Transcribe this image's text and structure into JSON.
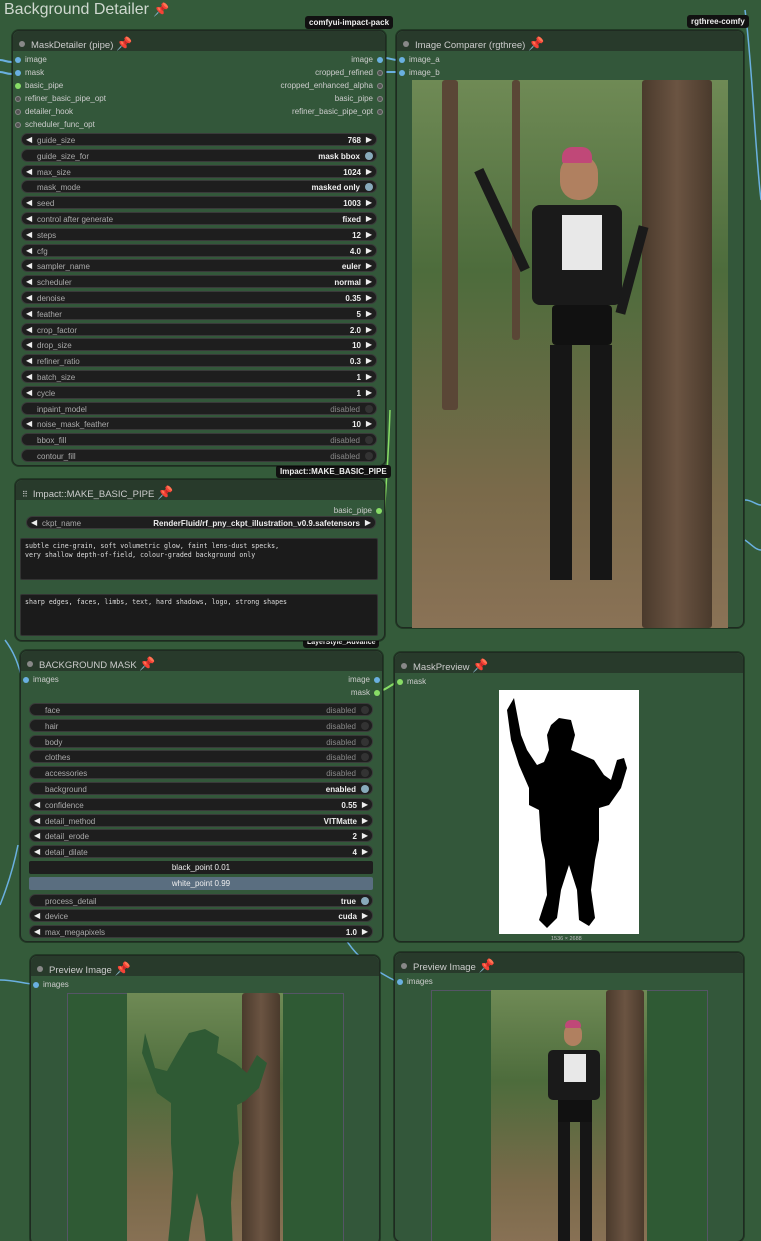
{
  "group": {
    "title": "Background Detailer",
    "pin": "📌"
  },
  "tags": {
    "impact_pack": "comfyui-impact-pack",
    "rgthree": "rgthree-comfy",
    "make_pipe": "Impact::MAKE_BASIC_PIPE",
    "layerstyle": "LayerStyle_Advance"
  },
  "mask_detailer": {
    "title": "MaskDetailer (pipe)",
    "inputs": [
      "image",
      "mask",
      "basic_pipe",
      "refiner_basic_pipe_opt",
      "detailer_hook",
      "scheduler_func_opt"
    ],
    "outputs": [
      "image",
      "cropped_refined",
      "cropped_enhanced_alpha",
      "basic_pipe",
      "refiner_basic_pipe_opt"
    ],
    "widgets": [
      {
        "label": "guide_size",
        "value": "768",
        "kind": "num"
      },
      {
        "label": "guide_size_for",
        "value": "mask bbox",
        "kind": "toggle-on"
      },
      {
        "label": "max_size",
        "value": "1024",
        "kind": "num"
      },
      {
        "label": "mask_mode",
        "value": "masked only",
        "kind": "toggle-on"
      },
      {
        "label": "seed",
        "value": "1003",
        "kind": "num"
      },
      {
        "label": "control after generate",
        "value": "fixed",
        "kind": "num"
      },
      {
        "label": "steps",
        "value": "12",
        "kind": "num"
      },
      {
        "label": "cfg",
        "value": "4.0",
        "kind": "num"
      },
      {
        "label": "sampler_name",
        "value": "euler",
        "kind": "num"
      },
      {
        "label": "scheduler",
        "value": "normal",
        "kind": "num"
      },
      {
        "label": "denoise",
        "value": "0.35",
        "kind": "num"
      },
      {
        "label": "feather",
        "value": "5",
        "kind": "num"
      },
      {
        "label": "crop_factor",
        "value": "2.0",
        "kind": "num"
      },
      {
        "label": "drop_size",
        "value": "10",
        "kind": "num"
      },
      {
        "label": "refiner_ratio",
        "value": "0.3",
        "kind": "num"
      },
      {
        "label": "batch_size",
        "value": "1",
        "kind": "num"
      },
      {
        "label": "cycle",
        "value": "1",
        "kind": "num"
      },
      {
        "label": "inpaint_model",
        "value": "disabled",
        "kind": "toggle-off"
      },
      {
        "label": "noise_mask_feather",
        "value": "10",
        "kind": "num"
      },
      {
        "label": "bbox_fill",
        "value": "disabled",
        "kind": "toggle-off"
      },
      {
        "label": "contour_fill",
        "value": "disabled",
        "kind": "toggle-off"
      }
    ]
  },
  "make_pipe": {
    "title": "Impact::MAKE_BASIC_PIPE",
    "output": "basic_pipe",
    "ckpt_label": "ckpt_name",
    "ckpt_value": "RenderFluid/rf_pny_ckpt_illustration_v0.9.safetensors",
    "positive": "subtle cine-grain, soft volumetric glow, faint lens-dust specks,\nvery shallow depth-of-field, colour-graded background only",
    "negative": "sharp edges, faces, limbs, text, hard shadows, logo, strong shapes"
  },
  "bg_mask": {
    "title": "BACKGROUND MASK",
    "input": "images",
    "outputs": [
      "image",
      "mask"
    ],
    "widgets": [
      {
        "label": "face",
        "value": "disabled",
        "kind": "toggle-off"
      },
      {
        "label": "hair",
        "value": "disabled",
        "kind": "toggle-off"
      },
      {
        "label": "body",
        "value": "disabled",
        "kind": "toggle-off"
      },
      {
        "label": "clothes",
        "value": "disabled",
        "kind": "toggle-off"
      },
      {
        "label": "accessories",
        "value": "disabled",
        "kind": "toggle-off"
      },
      {
        "label": "background",
        "value": "enabled",
        "kind": "toggle-on"
      },
      {
        "label": "confidence",
        "value": "0.55",
        "kind": "num"
      },
      {
        "label": "detail_method",
        "value": "VITMatte",
        "kind": "num"
      },
      {
        "label": "detail_erode",
        "value": "2",
        "kind": "num"
      },
      {
        "label": "detail_dilate",
        "value": "4",
        "kind": "num"
      }
    ],
    "black_point": "black_point  0.01",
    "white_point": "white_point  0.99",
    "widgets2": [
      {
        "label": "process_detail",
        "value": "true",
        "kind": "toggle-on"
      },
      {
        "label": "device",
        "value": "cuda",
        "kind": "num"
      },
      {
        "label": "max_megapixels",
        "value": "1.0",
        "kind": "num"
      }
    ]
  },
  "comparer": {
    "title": "Image Comparer (rgthree)",
    "inputs": [
      "image_a",
      "image_b"
    ]
  },
  "mask_preview": {
    "title": "MaskPreview",
    "input": "mask",
    "size": "1536 × 2688"
  },
  "preview1": {
    "title": "Preview Image",
    "input": "images"
  },
  "preview2": {
    "title": "Preview Image",
    "input": "images"
  }
}
